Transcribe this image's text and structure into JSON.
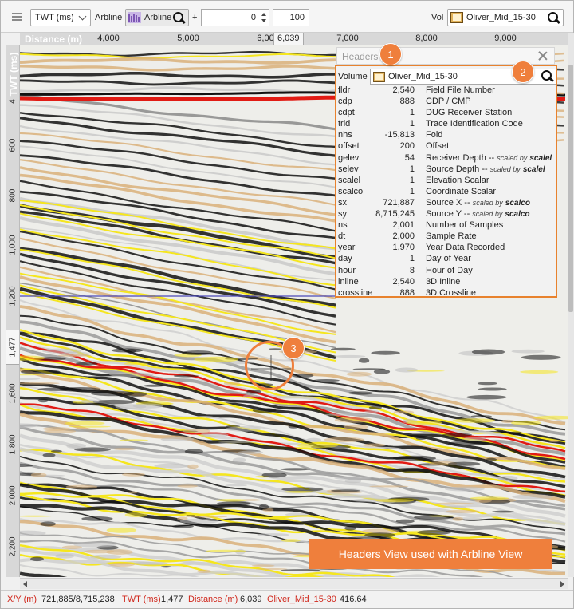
{
  "toolbar": {
    "domain_select": "TWT (ms)",
    "arbline_label": "Arbline",
    "arbline_picker": "Arbline",
    "plus_label": "+",
    "offset_value": "0",
    "length_value": "100",
    "vol_label": "Vol",
    "volume_picker": "Oliver_Mid_15-30"
  },
  "x_axis": {
    "title": "Distance (m)",
    "ticks": [
      "4,000",
      "5,000",
      "6,00",
      "7,000",
      "8,000",
      "9,000"
    ],
    "cursor_value": "6,039"
  },
  "y_axis": {
    "title": "TWT (ms)",
    "ticks": [
      "4",
      "600",
      "800",
      "1,000",
      "1,200",
      "1,600",
      "1,800",
      "2,000",
      "2,200"
    ],
    "cursor_value": "1,477"
  },
  "headers_panel": {
    "title": "Headers",
    "volume_label": "Volume",
    "volume_value": "Oliver_Mid_15-30",
    "rows": [
      {
        "key": "fldr",
        "value": "2,540",
        "desc": "Field File Number",
        "note": "",
        "scale": ""
      },
      {
        "key": "cdp",
        "value": "888",
        "desc": "CDP / CMP",
        "note": "",
        "scale": ""
      },
      {
        "key": "cdpt",
        "value": "1",
        "desc": "DUG Receiver Station",
        "note": "",
        "scale": ""
      },
      {
        "key": "trid",
        "value": "1",
        "desc": "Trace Identification Code",
        "note": "",
        "scale": ""
      },
      {
        "key": "nhs",
        "value": "-15,813",
        "desc": "Fold",
        "note": "",
        "scale": ""
      },
      {
        "key": "offset",
        "value": "200",
        "desc": "Offset",
        "note": "",
        "scale": ""
      },
      {
        "key": "gelev",
        "value": "54",
        "desc": "Receiver Depth --",
        "note": "scaled by",
        "scale": "scalel"
      },
      {
        "key": "selev",
        "value": "1",
        "desc": "Source Depth --",
        "note": "scaled by",
        "scale": "scalel"
      },
      {
        "key": "scalel",
        "value": "1",
        "desc": "Elevation Scalar",
        "note": "",
        "scale": ""
      },
      {
        "key": "scalco",
        "value": "1",
        "desc": "Coordinate Scalar",
        "note": "",
        "scale": ""
      },
      {
        "key": "sx",
        "value": "721,887",
        "desc": "Source X --",
        "note": "scaled by",
        "scale": "scalco"
      },
      {
        "key": "sy",
        "value": "8,715,245",
        "desc": "Source Y --",
        "note": "scaled by",
        "scale": "scalco"
      },
      {
        "key": "ns",
        "value": "2,001",
        "desc": "Number of Samples",
        "note": "",
        "scale": ""
      },
      {
        "key": "dt",
        "value": "2,000",
        "desc": "Sample Rate",
        "note": "",
        "scale": ""
      },
      {
        "key": "year",
        "value": "1,970",
        "desc": "Year Data Recorded",
        "note": "",
        "scale": ""
      },
      {
        "key": "day",
        "value": "1",
        "desc": "Day of Year",
        "note": "",
        "scale": ""
      },
      {
        "key": "hour",
        "value": "8",
        "desc": "Hour of Day",
        "note": "",
        "scale": ""
      },
      {
        "key": "inline",
        "value": "2,540",
        "desc": "3D Inline",
        "note": "",
        "scale": ""
      },
      {
        "key": "crossline",
        "value": "888",
        "desc": "3D Crossline",
        "note": "",
        "scale": ""
      }
    ]
  },
  "callouts": {
    "badge1": "1",
    "badge2": "2",
    "badge3": "3",
    "caption": "Headers View used with Arbline View"
  },
  "status_bar": {
    "xy_label": "X/Y (m)",
    "xy_value": "721,885/8,715,238",
    "twt_label": "TWT (ms)",
    "twt_value": "1,477",
    "distance_label": "Distance (m)",
    "distance_value": "6,039",
    "volume_name": "Oliver_Mid_15-30",
    "amplitude": "416.64"
  },
  "colors": {
    "accent": "#ef7f3c",
    "status_red": "#d0261b",
    "seismic_black": "#111111",
    "seismic_red": "#e11b14",
    "seismic_yellow": "#f5e61e",
    "seismic_tan": "#d9b07a",
    "horizon_line": "#4b48b8"
  }
}
